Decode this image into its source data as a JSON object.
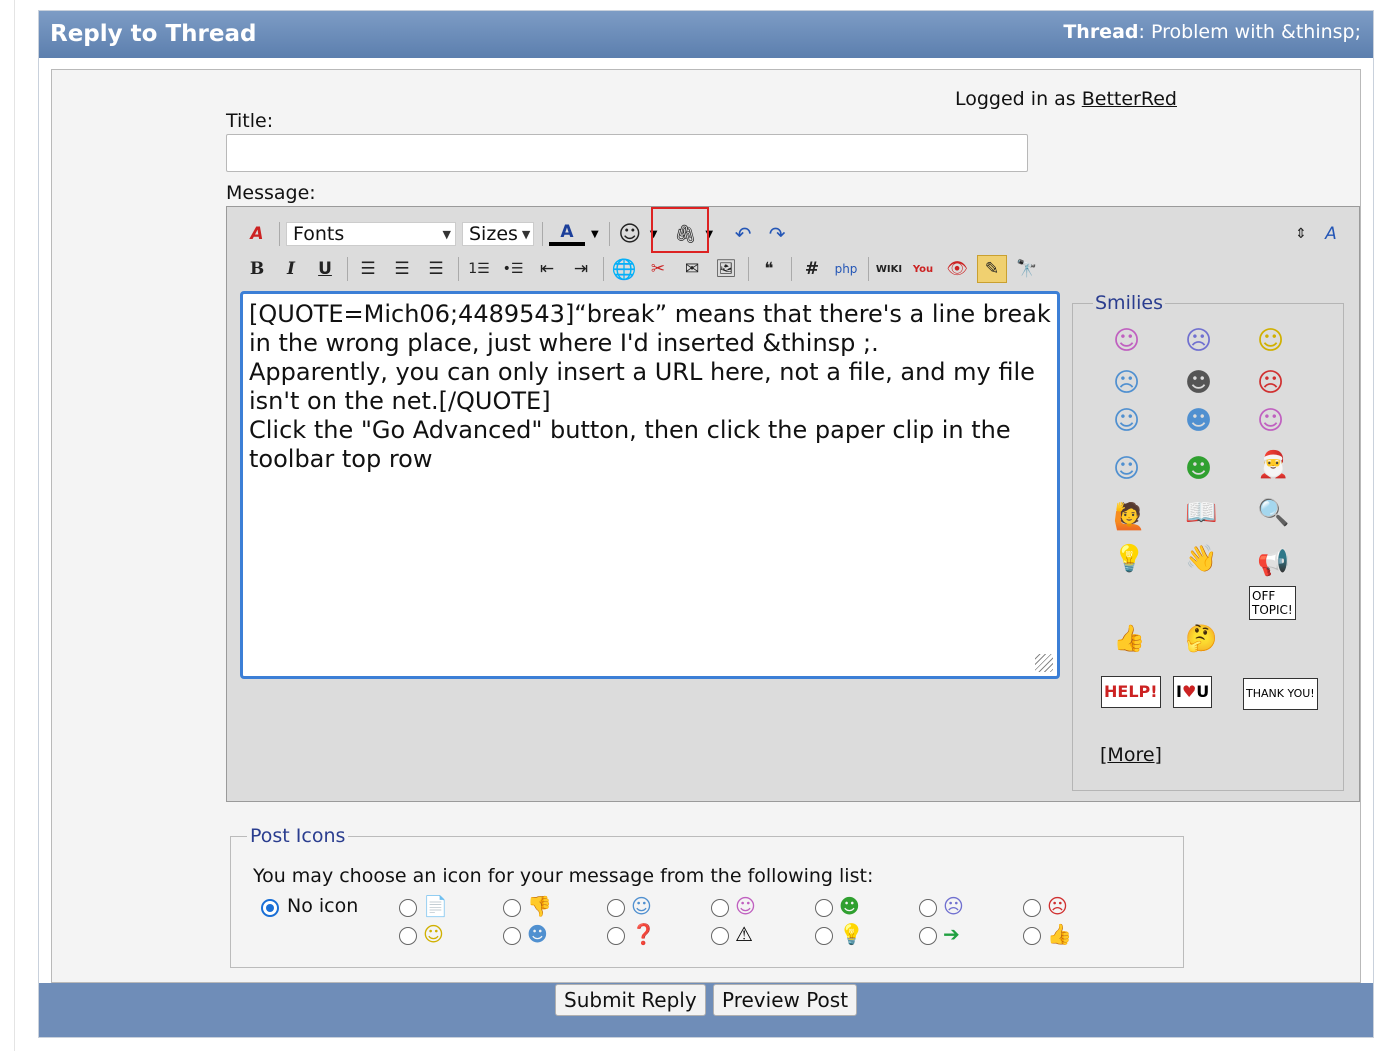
{
  "header": {
    "title": "Reply to Thread",
    "thread_label": "Thread",
    "thread_title": ": Problem with &thinsp;"
  },
  "logged_in": {
    "prefix": "Logged in as ",
    "user": "BetterRed"
  },
  "form": {
    "title_label": "Title:",
    "title_value": "",
    "message_label": "Message:"
  },
  "toolbar": {
    "fonts": "Fonts",
    "sizes": "Sizes"
  },
  "message": "[QUOTE=Mich06;4489543]“break” means that there's a line break in the wrong place, just where I'd inserted &thinsp ;.\nApparently, you can only insert a URL here, not a file, and my file isn't on the net.[/QUOTE]\nClick the \"Go Advanced\" button, then click the paper clip in the toolbar top row",
  "smilies": {
    "legend": "Smilies",
    "more": "More"
  },
  "post_icons": {
    "legend": "Post Icons",
    "instruction": "You may choose an icon for your message from the following list:",
    "no_icon": "No icon"
  },
  "buttons": {
    "submit": "Submit Reply",
    "preview": "Preview Post"
  }
}
